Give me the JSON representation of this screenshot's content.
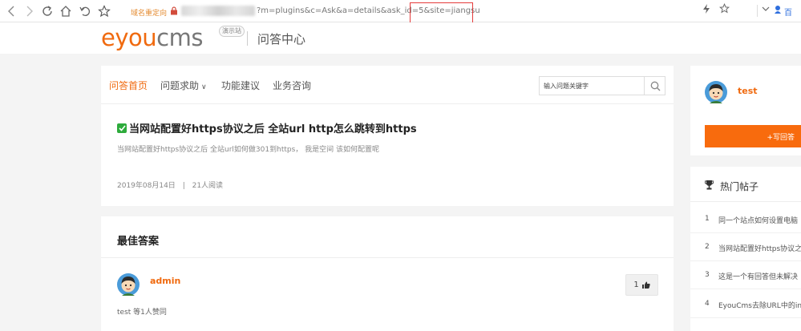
{
  "browser": {
    "redirect_label": "域名重定向",
    "url_visible": "?m=plugins&c=Ask&a=details&ask_id=5",
    "url_highlight": "&site=jiangsu",
    "right_text": "百"
  },
  "header": {
    "logo_e": "e",
    "logo_you": "you",
    "logo_cms": "cms",
    "demo_tag": "演示站",
    "title": "问答中心"
  },
  "tabs": [
    {
      "label": "问答首页"
    },
    {
      "label": "问题求助"
    },
    {
      "label": "功能建议"
    },
    {
      "label": "业务咨询"
    }
  ],
  "search": {
    "placeholder": "输入问题关键字"
  },
  "question": {
    "title": "当网站配置好https协议之后 全站url http怎么跳转到https",
    "description": "当网站配置好https协议之后  全站url如何做301到https， 我是空间  该如何配置呢",
    "date": "2019年08月14日",
    "separator": "|",
    "views": "21人阅读"
  },
  "answer": {
    "section_title": "最佳答案",
    "user": "admin",
    "likes": "1",
    "text": "test 等1人赞同"
  },
  "sidebar": {
    "user_name": "test",
    "answer_button": "+写回答",
    "hot_title": "热门帖子",
    "hot_items": [
      {
        "num": "1",
        "text": "同一个站点如何设置电脑"
      },
      {
        "num": "2",
        "text": "当网站配置好https协议之"
      },
      {
        "num": "3",
        "text": "这是一个有回答但未解决"
      },
      {
        "num": "4",
        "text": "EyouCms去除URL中的in"
      }
    ]
  },
  "colors": {
    "accent": "#f06a0f",
    "button": "#f86b0d",
    "check": "#2eab3c",
    "highlight_box": "#e43c3c"
  }
}
